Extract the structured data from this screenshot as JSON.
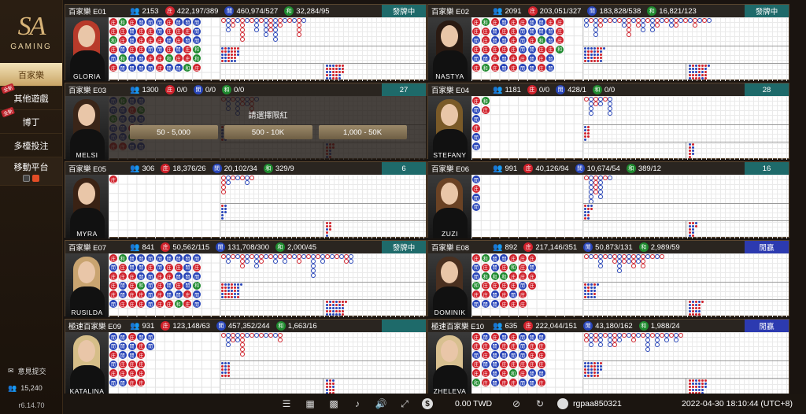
{
  "brand": {
    "mark": "SA",
    "word": "GAMING"
  },
  "sidebar": {
    "items": [
      {
        "label": "百家樂",
        "active": true,
        "tag": ""
      },
      {
        "label": "其他遊戲",
        "active": false,
        "tag": "全新"
      },
      {
        "label": "博丁",
        "active": false,
        "tag": "全新"
      },
      {
        "label": "多檯投注",
        "active": false,
        "tag": ""
      }
    ],
    "mobile_label": "移動平台",
    "feedback_label": "意見提交",
    "online_count": "15,240",
    "version": "r6.14.70"
  },
  "tables": [
    {
      "name": "百家樂 E01",
      "players": "2153",
      "banker": "422,197/389",
      "player": "460,974/527",
      "tie": "32,284/95",
      "status": "發牌中",
      "status_color": "#1e6a6a",
      "dealer": "GLORIA",
      "hair": "#b83a2a"
    },
    {
      "name": "百家樂 E02",
      "players": "2091",
      "banker": "203,051/327",
      "player": "183,828/538",
      "tie": "16,821/123",
      "status": "發牌中",
      "status_color": "#1e6a6a",
      "dealer": "NASTYA",
      "hair": "#2a1a12"
    },
    {
      "name": "百家樂 E03",
      "players": "1300",
      "banker": "0/0",
      "player": "0/0",
      "tie": "0/0",
      "status": "27",
      "status_color": "#1e6a6a",
      "dealer": "MELSI",
      "hair": "#3a2518"
    },
    {
      "name": "百家樂 E04",
      "players": "1181",
      "banker": "0/0",
      "player": "428/1",
      "tie": "0/0",
      "status": "28",
      "status_color": "#1e6a6a",
      "dealer": "STEFANY",
      "hair": "#7a5a28"
    },
    {
      "name": "百家樂 E05",
      "players": "306",
      "banker": "18,376/26",
      "player": "20,102/34",
      "tie": "329/9",
      "status": "6",
      "status_color": "#1e6a6a",
      "dealer": "MYRA",
      "hair": "#3a2214"
    },
    {
      "name": "百家樂 E06",
      "players": "991",
      "banker": "40,126/94",
      "player": "10,674/54",
      "tie": "389/12",
      "status": "16",
      "status_color": "#1e6a6a",
      "dealer": "ZUZI",
      "hair": "#6a4224"
    },
    {
      "name": "百家樂 E07",
      "players": "841",
      "banker": "50,562/115",
      "player": "131,708/300",
      "tie": "2,000/45",
      "status": "發牌中",
      "status_color": "#1e6a6a",
      "dealer": "RUSILDA",
      "hair": "#c9a470"
    },
    {
      "name": "百家樂 E08",
      "players": "892",
      "banker": "217,146/351",
      "player": "50,873/131",
      "tie": "2,989/59",
      "status": "閒贏",
      "status_color": "#2c3ab0",
      "dealer": "DOMINIK",
      "hair": "#4a3020"
    },
    {
      "name": "極速百家樂 E09",
      "players": "931",
      "banker": "123,148/63",
      "player": "457,352/244",
      "tie": "1,663/16",
      "status": "",
      "status_color": "#1e6a6a",
      "dealer": "KATALINA",
      "hair": "#d6be88"
    },
    {
      "name": "極速百家樂 E10",
      "players": "635",
      "banker": "222,044/151",
      "player": "43,180/162",
      "tie": "1,988/24",
      "status": "閒贏",
      "status_color": "#2c3ab0",
      "dealer": "ZHELEVA",
      "hair": "#d8c090"
    }
  ],
  "labels": {
    "banker": "庄",
    "player": "閒",
    "tie": "和"
  },
  "overlay": {
    "title": "請選擇限紅",
    "options": [
      "50 - 5,000",
      "500 - 10K",
      "1,000 - 50K"
    ]
  },
  "bottombar": {
    "balance": "0.00 TWD",
    "username": "rgpaa850321",
    "datetime": "2022-04-30  18:10:44 (UTC+8)"
  },
  "colors": {
    "banker": "#d0202a",
    "player": "#2744b8",
    "tie": "#1e8a2e",
    "accent": "#c9a566"
  }
}
